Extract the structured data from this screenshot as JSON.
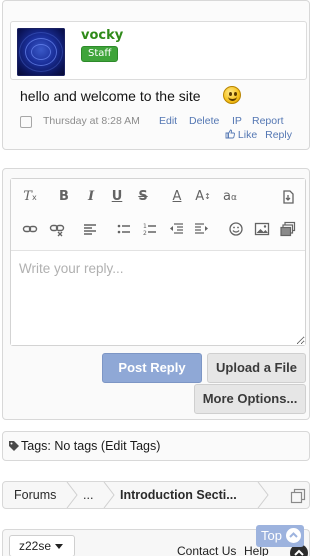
{
  "post": {
    "username": "vocky",
    "badge": "Staff",
    "message": "hello and welcome to the site",
    "timestamp": "Thursday at 8:28 AM",
    "actions": [
      "Edit",
      "Delete",
      "IP",
      "Report"
    ],
    "like_label": "Like",
    "reply_label": "Reply"
  },
  "editor": {
    "placeholder": "Write your reply...",
    "toolbar_icons": [
      "clear-format-icon",
      "bold-icon",
      "italic-icon",
      "underline-icon",
      "strikethrough-icon",
      "text-color-icon",
      "font-size-icon",
      "font-family-icon",
      "drafts-icon",
      "link-icon",
      "unlink-icon",
      "align-icon",
      "bullet-list-icon",
      "numbered-list-icon",
      "outdent-icon",
      "indent-icon",
      "smilies-icon",
      "image-icon",
      "media-icon"
    ]
  },
  "buttons": {
    "post_reply": "Post Reply",
    "upload": "Upload a File",
    "more": "More Options..."
  },
  "tags": {
    "text": "Tags: No tags (Edit Tags)"
  },
  "breadcrumb": {
    "items": [
      "Forums",
      "...",
      "Introduction Secti..."
    ]
  },
  "footer": {
    "style": "z22se",
    "contact": "Contact Us",
    "help": "Help",
    "top": "Top"
  },
  "colors": {
    "username": "#2f8a19",
    "staff_badge": "#3fa43a",
    "link": "#5477b3",
    "primary_button": "#8fa8d6"
  }
}
